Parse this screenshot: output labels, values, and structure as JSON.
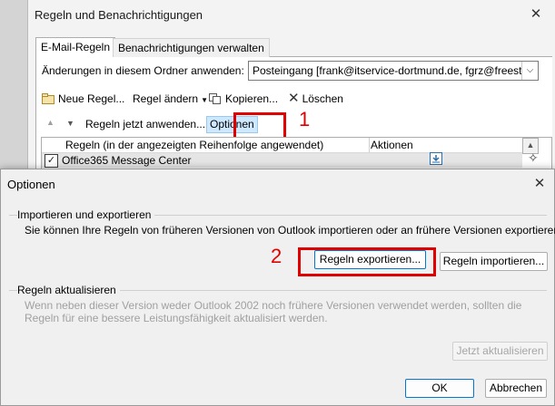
{
  "rules_window": {
    "title": "Regeln und Benachrichtigungen",
    "close_glyph": "✕",
    "tabs": [
      {
        "label": "E-Mail-Regeln",
        "active": true
      },
      {
        "label": "Benachrichtigungen verwalten",
        "active": false
      }
    ],
    "folder_label": "Änderungen in diesem Ordner anwenden:",
    "folder_value": "Posteingang [frank@itservice-dortmund.de, fgrz@freesty",
    "toolbar": {
      "new_rule": "Neue Regel...",
      "change_rule": "Regel ändern",
      "copy": "Kopieren...",
      "delete": "Löschen"
    },
    "apply_now": "Regeln jetzt anwenden...",
    "options_link": "Optionen",
    "callout_1": "1",
    "table": {
      "col_rules": "Regeln (in der angezeigten Reihenfolge angewendet)",
      "col_actions": "Aktionen",
      "rows": [
        {
          "name": "Office365 Message Center",
          "checked": true
        }
      ]
    }
  },
  "options_dialog": {
    "title": "Optionen",
    "close_glyph": "✕",
    "import_export": {
      "group_title": "Importieren und exportieren",
      "description": "Sie können Ihre Regeln von früheren Versionen von Outlook importieren oder an frühere Versionen exportieren.",
      "export_button": "Regeln exportieren...",
      "import_button": "Regeln importieren...",
      "callout_2": "2"
    },
    "update_rules": {
      "group_title": "Regeln aktualisieren",
      "description": "Wenn neben dieser Version weder Outlook 2002 noch frühere Versionen verwendet werden, sollten die Regeln für eine bessere Leistungsfähigkeit aktualisiert werden.",
      "update_button": "Jetzt aktualisieren"
    },
    "ok_button": "OK",
    "cancel_button": "Abbrechen"
  },
  "colors": {
    "callout_red": "#e00000",
    "highlight_blue": "#cde8ff",
    "focus_blue": "#0078d4"
  }
}
